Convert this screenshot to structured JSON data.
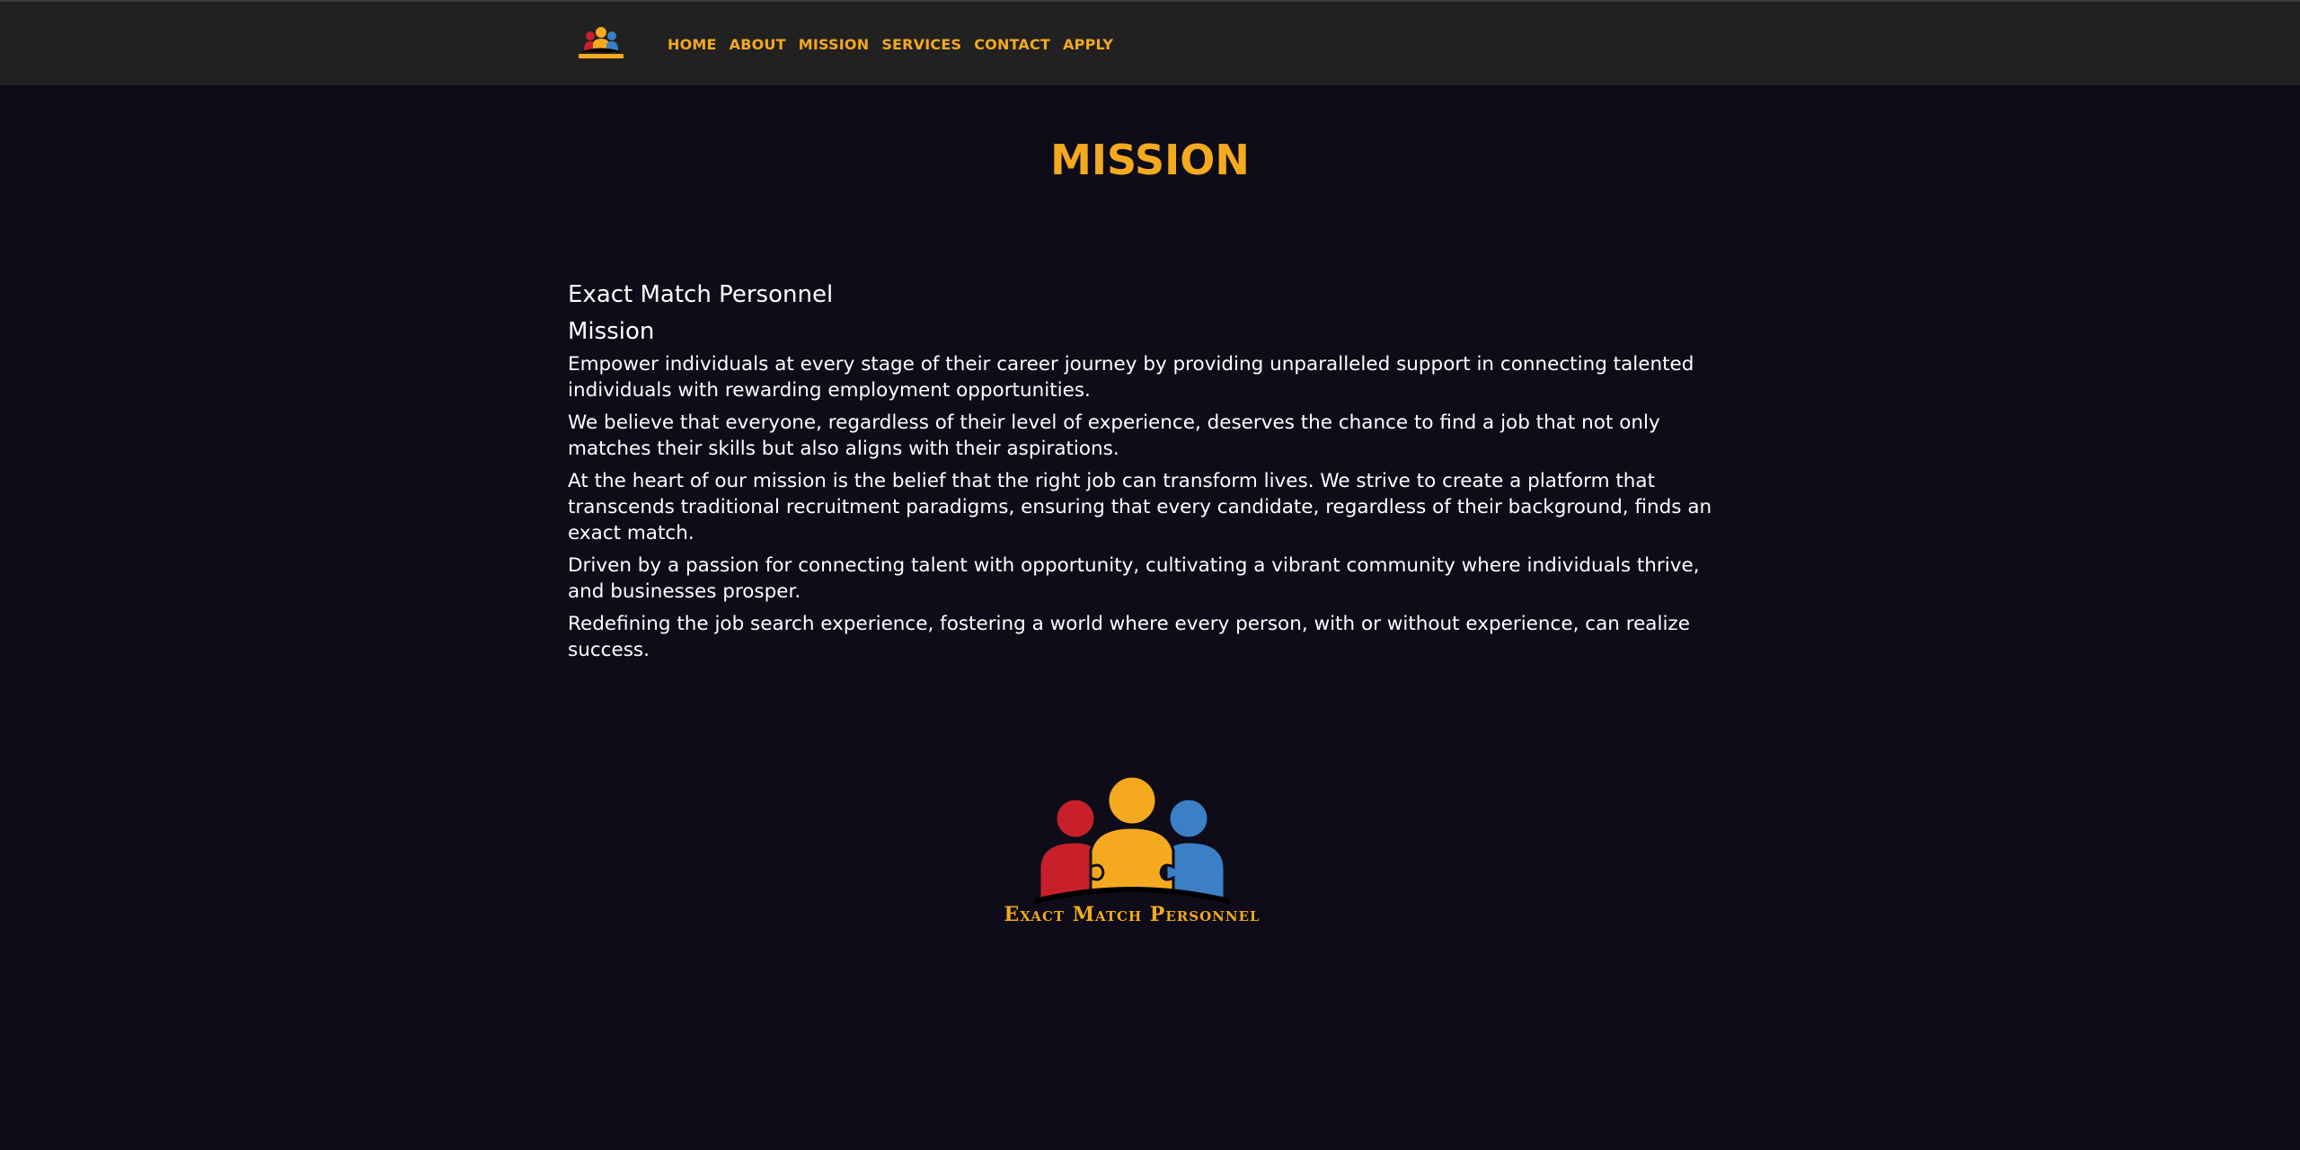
{
  "nav": {
    "logo_text": "Exact Match Personnel",
    "items": [
      {
        "label": "HOME"
      },
      {
        "label": "ABOUT"
      },
      {
        "label": "MISSION"
      },
      {
        "label": "SERVICES"
      },
      {
        "label": "CONTACT"
      },
      {
        "label": "APPLY"
      }
    ]
  },
  "page": {
    "title": "MISSION",
    "company_name": "Exact Match Personnel",
    "section_heading": "Mission",
    "paragraphs": [
      "Empower individuals at every stage of their career journey by providing unparalleled support in connecting talented individuals with rewarding employment opportunities.",
      "We believe that everyone, regardless of their level of experience, deserves the chance to find a job that not only matches their skills but also aligns with their aspirations.",
      "At the heart of our mission is the belief that the right job can transform lives. We strive to create a platform that transcends traditional recruitment paradigms, ensuring that every candidate, regardless of their background, finds an exact match.",
      "Driven by a passion for connecting talent with opportunity, cultivating a vibrant community where individuals thrive, and businesses prosper.",
      "Redefining the job search experience, fostering a world where every person, with or without experience, can realize success."
    ]
  },
  "footer": {
    "logo_text": "Exact Match Personnel"
  },
  "colors": {
    "accent": "#f4a91f",
    "background": "#0d0c18",
    "navbar": "#222121",
    "text": "#ffffff",
    "logo_red": "#c8202a",
    "logo_yellow": "#f4a91f",
    "logo_blue": "#3b7fc7"
  },
  "icons": {
    "nav_logo": "people-puzzle-logo-icon",
    "footer_logo": "people-puzzle-logo-icon"
  }
}
